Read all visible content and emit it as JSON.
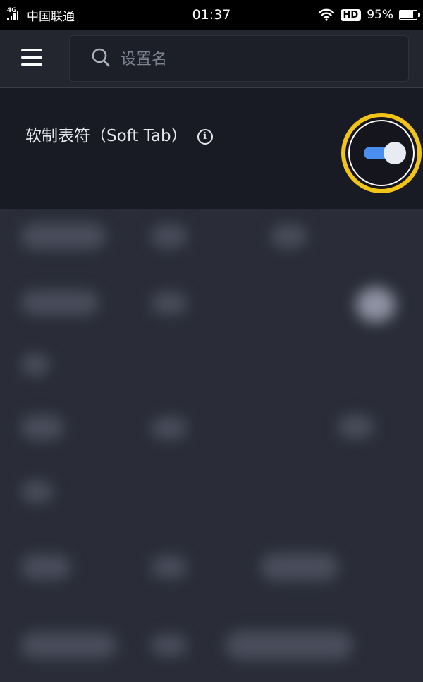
{
  "status_bar": {
    "network_type": "4G",
    "carrier": "中国联通",
    "time": "01:37",
    "hd_badge": "HD",
    "battery_percent": "95%",
    "battery_level": 0.95
  },
  "top_bar": {
    "menu_icon": "hamburger-menu-icon",
    "search": {
      "icon": "search-icon",
      "placeholder": "设置名",
      "value": ""
    }
  },
  "setting": {
    "label": "软制表符（Soft Tab）",
    "info_icon": "info-icon",
    "info_glyph": "i",
    "toggle_state": "on",
    "highlight_color": "#f2c418",
    "toggle_color": "#4a8ff0"
  }
}
